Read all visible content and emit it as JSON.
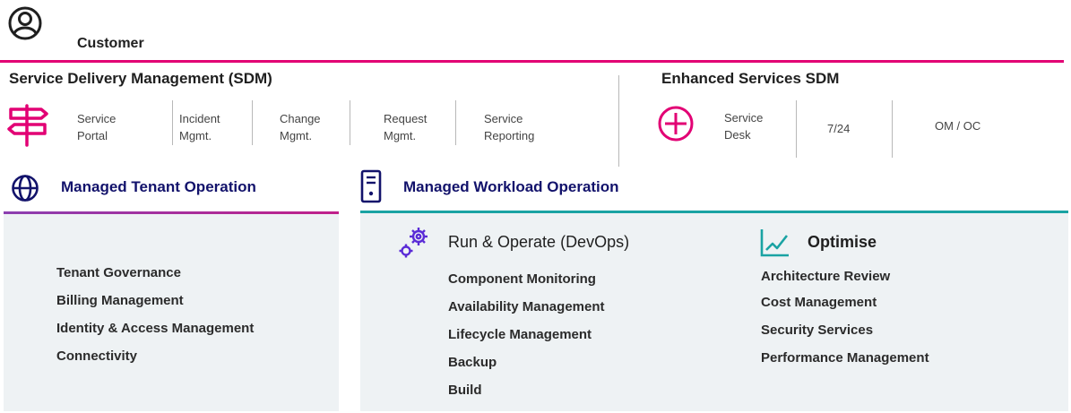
{
  "customer": {
    "label": "Customer",
    "icon": "user-circle-icon"
  },
  "sdm": {
    "title": "Service Delivery Management (SDM)",
    "icon": "signpost-icon",
    "items": [
      {
        "line1": "Service",
        "line2": "Portal"
      },
      {
        "line1": "Incident",
        "line2": "Mgmt."
      },
      {
        "line1": "Change",
        "line2": "Mgmt."
      },
      {
        "line1": "Request",
        "line2": "Mgmt."
      },
      {
        "line1": "Service",
        "line2": "Reporting"
      }
    ]
  },
  "enhanced": {
    "title": "Enhanced Services SDM",
    "icon": "plus-circle-icon",
    "items": [
      {
        "line1": "Service",
        "line2": "Desk"
      },
      {
        "line1": "7/24"
      },
      {
        "line1": "OM / OC"
      }
    ]
  },
  "tenant": {
    "title": "Managed Tenant Operation",
    "icon": "globe-icon",
    "items": [
      "Tenant Governance",
      "Billing Management",
      "Identity & Access Management",
      "Connectivity"
    ]
  },
  "workload": {
    "title": "Managed Workload Operation",
    "icon": "server-icon",
    "run": {
      "title": "Run & Operate (DevOps)",
      "icon": "gears-icon",
      "items": [
        "Component Monitoring",
        "Availability Management",
        "Lifecycle Management",
        "Backup",
        "Build"
      ]
    },
    "optimise": {
      "title": "Optimise",
      "icon": "trend-chart-icon",
      "items": [
        "Architecture Review",
        "Cost Management",
        "Security Services",
        "Performance Management"
      ]
    }
  },
  "colors": {
    "magenta": "#e20074",
    "purple": "#8b3fb0",
    "teal": "#1aa3a3",
    "navy": "#12126b",
    "icon_purple": "#5a2bd6",
    "panel_bg": "#eef2f4"
  }
}
